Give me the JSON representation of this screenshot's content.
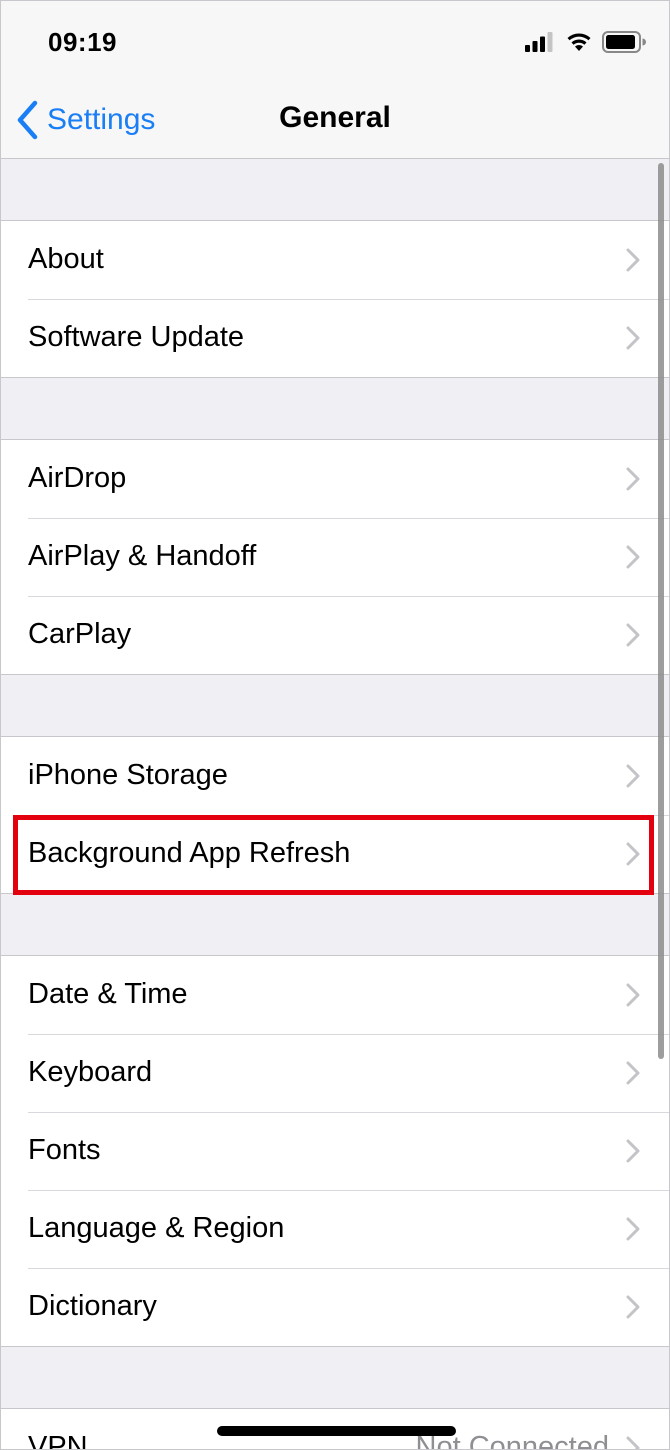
{
  "status_bar": {
    "time": "09:19",
    "signal_icon": "cellular-signal-icon",
    "wifi_icon": "wifi-icon",
    "battery_icon": "battery-icon"
  },
  "nav": {
    "back_label": "Settings",
    "title": "General"
  },
  "accent_color": "#1a7ef5",
  "highlight_color": "#e3000f",
  "groups": [
    {
      "items": [
        {
          "label": "About"
        },
        {
          "label": "Software Update"
        }
      ]
    },
    {
      "items": [
        {
          "label": "AirDrop"
        },
        {
          "label": "AirPlay & Handoff"
        },
        {
          "label": "CarPlay"
        }
      ]
    },
    {
      "items": [
        {
          "label": "iPhone Storage"
        },
        {
          "label": "Background App Refresh",
          "highlighted": true
        }
      ]
    },
    {
      "items": [
        {
          "label": "Date & Time"
        },
        {
          "label": "Keyboard"
        },
        {
          "label": "Fonts"
        },
        {
          "label": "Language & Region"
        },
        {
          "label": "Dictionary"
        }
      ]
    },
    {
      "items": [
        {
          "label": "VPN",
          "value": "Not Connected"
        }
      ]
    }
  ]
}
